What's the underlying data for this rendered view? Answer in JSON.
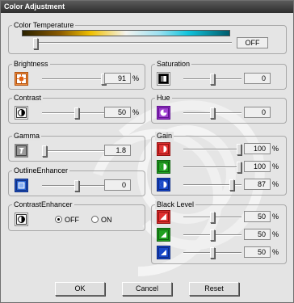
{
  "window": {
    "title": "Color Adjustment"
  },
  "color_temperature": {
    "label": "Color Temperature",
    "value": "OFF",
    "level": 0.0
  },
  "brightness": {
    "label": "Brightness",
    "value": "91",
    "unit": "%",
    "level": 0.91
  },
  "contrast": {
    "label": "Contrast",
    "value": "50",
    "unit": "%",
    "level": 0.5
  },
  "gamma": {
    "label": "Gamma",
    "value": "1.8",
    "level": 0.0
  },
  "outline_enhancer": {
    "label": "OutlineEnhancer",
    "value": "0",
    "level": 0.5
  },
  "contrast_enhancer": {
    "label": "ContrastEnhancer",
    "options": [
      "OFF",
      "ON"
    ],
    "selected": "OFF"
  },
  "saturation": {
    "label": "Saturation",
    "value": "0",
    "level": 0.5
  },
  "hue": {
    "label": "Hue",
    "value": "0",
    "level": 0.5
  },
  "gain": {
    "label": "Gain",
    "channels": [
      {
        "value": "100",
        "unit": "%",
        "level": 1.0,
        "color": "#e03030"
      },
      {
        "value": "100",
        "unit": "%",
        "level": 1.0,
        "color": "#20a020"
      },
      {
        "value": "87",
        "unit": "%",
        "level": 0.87,
        "color": "#1848c8"
      }
    ]
  },
  "black_level": {
    "label": "Black Level",
    "channels": [
      {
        "value": "50",
        "unit": "%",
        "level": 0.5,
        "color": "#e03030"
      },
      {
        "value": "50",
        "unit": "%",
        "level": 0.5,
        "color": "#20a020"
      },
      {
        "value": "50",
        "unit": "%",
        "level": 0.5,
        "color": "#1848c8"
      }
    ]
  },
  "buttons": {
    "ok": "OK",
    "cancel": "Cancel",
    "reset": "Reset"
  },
  "colors": {
    "titlebar": "#3c3c3c",
    "window_bg": "#e4e4e4",
    "red": "#e03030",
    "green": "#20a020",
    "blue": "#1848c8",
    "purple": "#9030c0",
    "orange": "#e06010"
  }
}
